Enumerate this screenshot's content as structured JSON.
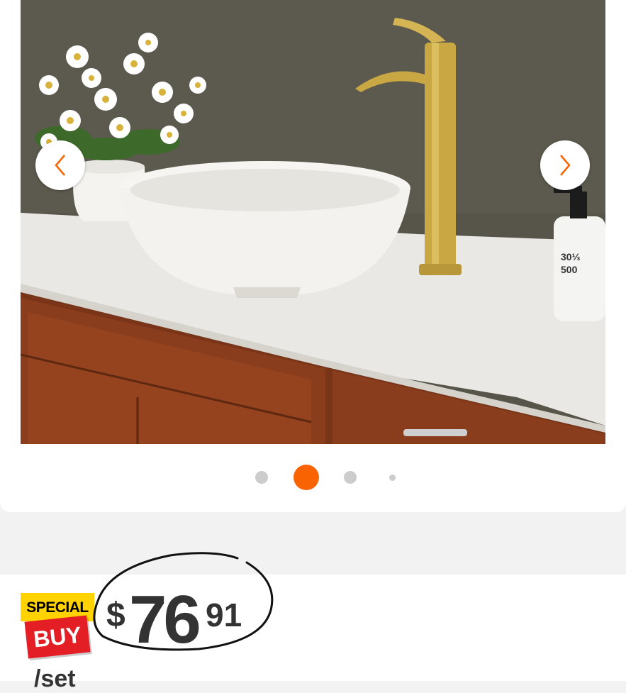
{
  "gallery": {
    "image_alt": "White vessel sink with gold faucet on wood vanity",
    "prev_icon": "chevron-left-icon",
    "next_icon": "chevron-right-icon",
    "dots": {
      "count": 4,
      "active_index": 1
    },
    "soap_label_1": "30⅓",
    "soap_label_2": "500"
  },
  "price_info": {
    "badge_top": "SPECIAL",
    "badge_bottom": "BUY",
    "currency": "$",
    "whole": "76",
    "cents": "91",
    "unit": "/set"
  },
  "colors": {
    "accent": "#f96302",
    "badge_yellow": "#ffd200",
    "badge_red": "#e31e24",
    "price_text": "#333333"
  }
}
